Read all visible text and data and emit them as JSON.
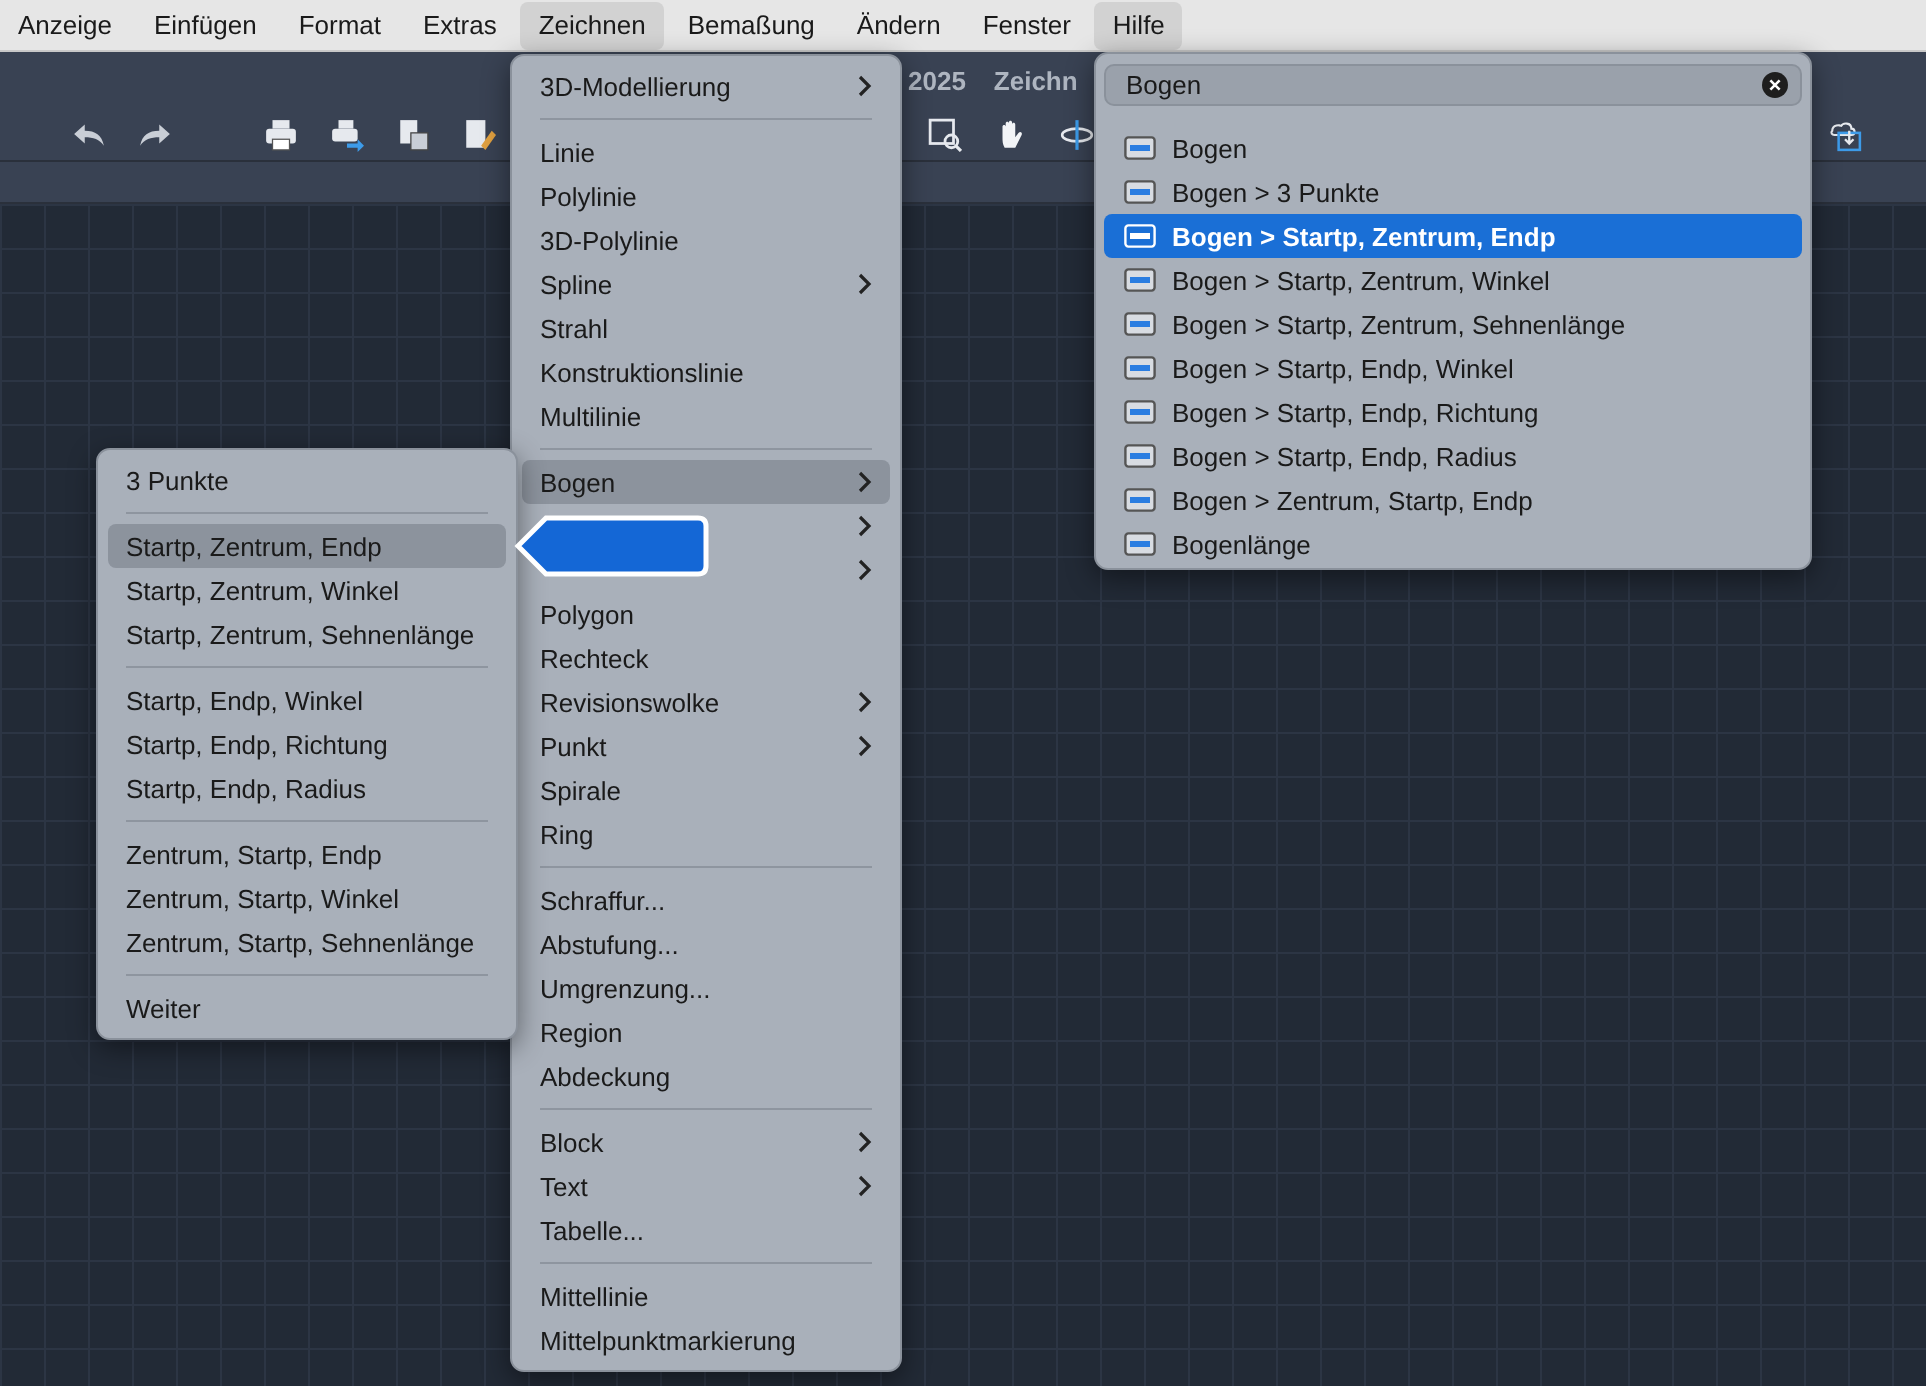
{
  "menubar": [
    {
      "label": "Anzeige",
      "selected": false
    },
    {
      "label": "Einfügen",
      "selected": false
    },
    {
      "label": "Format",
      "selected": false
    },
    {
      "label": "Extras",
      "selected": false
    },
    {
      "label": "Zeichnen",
      "selected": true
    },
    {
      "label": "Bemaßung",
      "selected": false
    },
    {
      "label": "Ändern",
      "selected": false
    },
    {
      "label": "Fenster",
      "selected": false
    },
    {
      "label": "Hilfe",
      "selected": true
    }
  ],
  "app_title": [
    "2025",
    "Zeichn"
  ],
  "draw_menu": {
    "sections": [
      [
        {
          "kind": "item",
          "label": "3D-Modellierung",
          "submenu": true,
          "selected": false
        }
      ],
      [
        {
          "kind": "item",
          "label": "Linie",
          "submenu": false,
          "selected": false
        },
        {
          "kind": "item",
          "label": "Polylinie",
          "submenu": false,
          "selected": false
        },
        {
          "kind": "item",
          "label": "3D-Polylinie",
          "submenu": false,
          "selected": false
        },
        {
          "kind": "item",
          "label": "Spline",
          "submenu": true,
          "selected": false
        },
        {
          "kind": "item",
          "label": "Strahl",
          "submenu": false,
          "selected": false
        },
        {
          "kind": "item",
          "label": "Konstruktionslinie",
          "submenu": false,
          "selected": false
        },
        {
          "kind": "item",
          "label": "Multilinie",
          "submenu": false,
          "selected": false
        }
      ],
      [
        {
          "kind": "item",
          "label": "Bogen",
          "submenu": true,
          "selected": true
        },
        {
          "kind": "obscured",
          "submenu": true,
          "selected": false
        },
        {
          "kind": "obscured",
          "submenu": true,
          "selected": false
        },
        {
          "kind": "item",
          "label": "Polygon",
          "submenu": false,
          "selected": false
        },
        {
          "kind": "item",
          "label": "Rechteck",
          "submenu": false,
          "selected": false
        },
        {
          "kind": "item",
          "label": "Revisionswolke",
          "submenu": true,
          "selected": false
        },
        {
          "kind": "item",
          "label": "Punkt",
          "submenu": true,
          "selected": false
        },
        {
          "kind": "item",
          "label": "Spirale",
          "submenu": false,
          "selected": false
        },
        {
          "kind": "item",
          "label": "Ring",
          "submenu": false,
          "selected": false
        }
      ],
      [
        {
          "kind": "item",
          "label": "Schraffur...",
          "submenu": false,
          "selected": false
        },
        {
          "kind": "item",
          "label": "Abstufung...",
          "submenu": false,
          "selected": false
        },
        {
          "kind": "item",
          "label": "Umgrenzung...",
          "submenu": false,
          "selected": false
        },
        {
          "kind": "item",
          "label": "Region",
          "submenu": false,
          "selected": false
        },
        {
          "kind": "item",
          "label": "Abdeckung",
          "submenu": false,
          "selected": false
        }
      ],
      [
        {
          "kind": "item",
          "label": "Block",
          "submenu": true,
          "selected": false
        },
        {
          "kind": "item",
          "label": "Text",
          "submenu": true,
          "selected": false
        },
        {
          "kind": "item",
          "label": "Tabelle...",
          "submenu": false,
          "selected": false
        }
      ],
      [
        {
          "kind": "item",
          "label": "Mittellinie",
          "submenu": false,
          "selected": false
        },
        {
          "kind": "item",
          "label": "Mittelpunktmarkierung",
          "submenu": false,
          "selected": false
        }
      ]
    ]
  },
  "arc_submenu": {
    "sections": [
      [
        {
          "label": "3 Punkte",
          "selected": false
        }
      ],
      [
        {
          "label": "Startp, Zentrum, Endp",
          "selected": true
        },
        {
          "label": "Startp, Zentrum, Winkel",
          "selected": false
        },
        {
          "label": "Startp, Zentrum, Sehnenlänge",
          "selected": false
        }
      ],
      [
        {
          "label": "Startp, Endp, Winkel",
          "selected": false
        },
        {
          "label": "Startp, Endp, Richtung",
          "selected": false
        },
        {
          "label": "Startp, Endp, Radius",
          "selected": false
        }
      ],
      [
        {
          "label": "Zentrum, Startp, Endp",
          "selected": false
        },
        {
          "label": "Zentrum, Startp, Winkel",
          "selected": false
        },
        {
          "label": "Zentrum, Startp, Sehnenlänge",
          "selected": false
        }
      ],
      [
        {
          "label": "Weiter",
          "selected": false
        }
      ]
    ]
  },
  "help_menu": {
    "search": {
      "value": "Bogen"
    },
    "results": [
      {
        "label": "Bogen",
        "selected": false
      },
      {
        "label": "Bogen > 3 Punkte",
        "selected": false
      },
      {
        "label": "Bogen > Startp, Zentrum, Endp",
        "selected": true
      },
      {
        "label": "Bogen > Startp, Zentrum, Winkel",
        "selected": false
      },
      {
        "label": "Bogen > Startp, Zentrum, Sehnenlänge",
        "selected": false
      },
      {
        "label": "Bogen > Startp, Endp, Winkel",
        "selected": false
      },
      {
        "label": "Bogen > Startp, Endp, Richtung",
        "selected": false
      },
      {
        "label": "Bogen > Startp, Endp, Radius",
        "selected": false
      },
      {
        "label": "Bogen > Zentrum, Startp, Endp",
        "selected": false
      },
      {
        "label": "Bogenlänge",
        "selected": false
      }
    ]
  }
}
